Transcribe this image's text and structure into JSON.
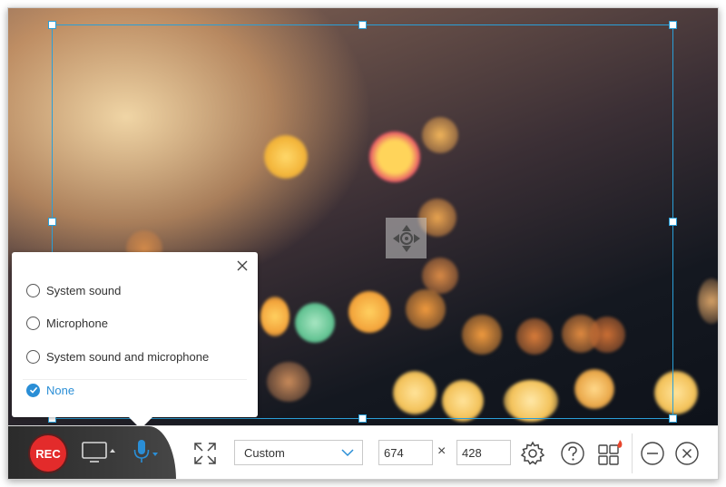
{
  "popup": {
    "options": [
      {
        "label": "System sound",
        "checked": false
      },
      {
        "label": "Microphone",
        "checked": false
      },
      {
        "label": "System sound and microphone",
        "checked": false
      },
      {
        "label": "None",
        "checked": true
      }
    ],
    "close_icon": "close-icon"
  },
  "toolbar": {
    "rec_label": "REC",
    "size_mode": "Custom",
    "width": "674",
    "height": "428",
    "times_symbol": "×",
    "icons": [
      "monitor-icon",
      "microphone-icon",
      "fullscreen-icon",
      "gear-icon",
      "help-icon",
      "apps-icon",
      "minimize-icon",
      "close-icon"
    ]
  },
  "colors": {
    "accent": "#2a8ed6",
    "selection_border": "#2a9fd8",
    "rec_red": "#e32b2b"
  }
}
